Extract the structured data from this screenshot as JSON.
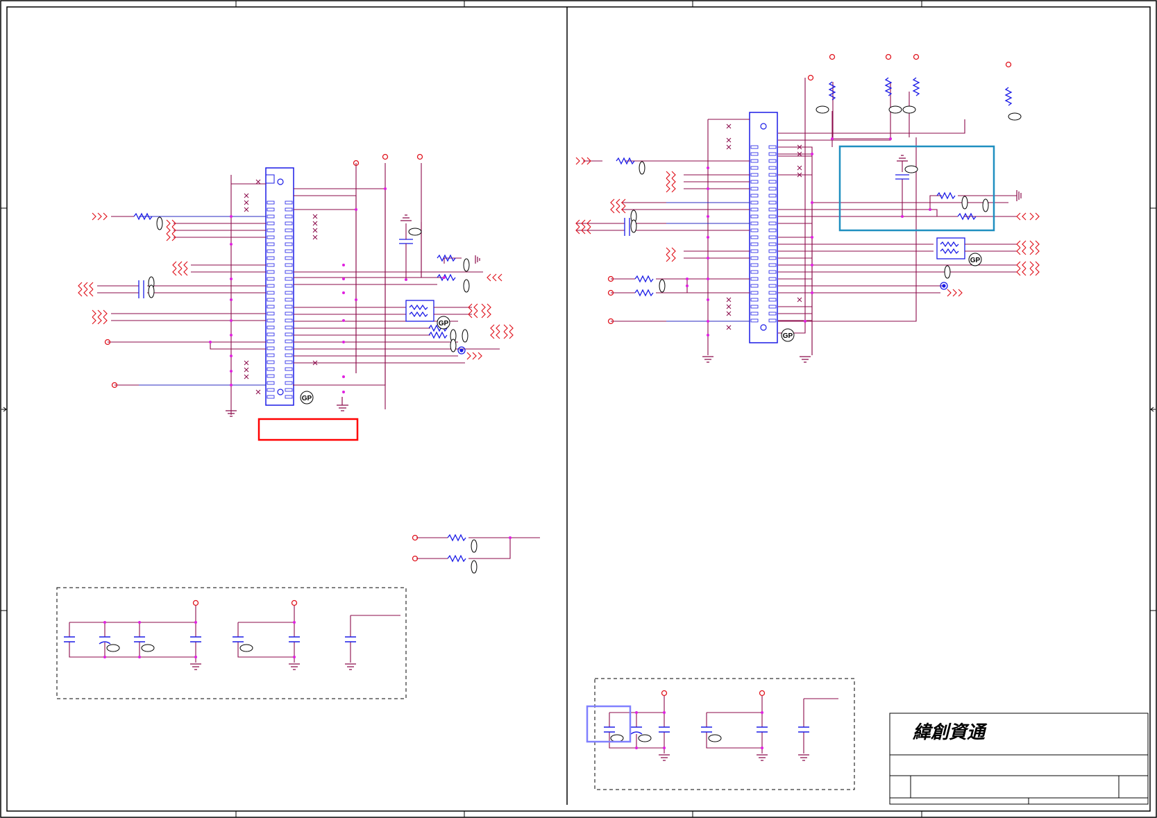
{
  "title_block": {
    "company": "緯創資通"
  },
  "badges": {
    "gp": "GP"
  },
  "colors": {
    "wire": "#8b0a4a",
    "wire_red": "#e0141e",
    "connector": "#1a1ae6",
    "junction": "#e020e0",
    "frame": "#000000",
    "highlight_red": "#ff0000",
    "highlight_teal": "#1f8fc0",
    "highlight_violet": "#8080ff"
  }
}
